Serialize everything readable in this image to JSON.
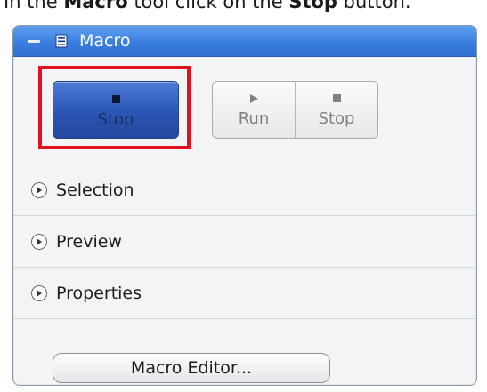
{
  "instruction": {
    "prefix": "In the ",
    "tool": "Macro",
    "middle": " tool click on the ",
    "button": "Stop",
    "suffix": " button."
  },
  "panel": {
    "title": "Macro",
    "accent_color": "#3b7fe0",
    "highlight_color": "#e0121f"
  },
  "buttons": {
    "big_stop": "Stop",
    "run": "Run",
    "stop": "Stop",
    "macro_editor": "Macro Editor..."
  },
  "sections": [
    {
      "label": "Selection"
    },
    {
      "label": "Preview"
    },
    {
      "label": "Properties"
    }
  ],
  "icons": {
    "collapse": "minus-icon",
    "tool": "macro-icon",
    "expander": "expand-arrow-icon",
    "run": "play-icon",
    "stop": "stop-icon"
  }
}
